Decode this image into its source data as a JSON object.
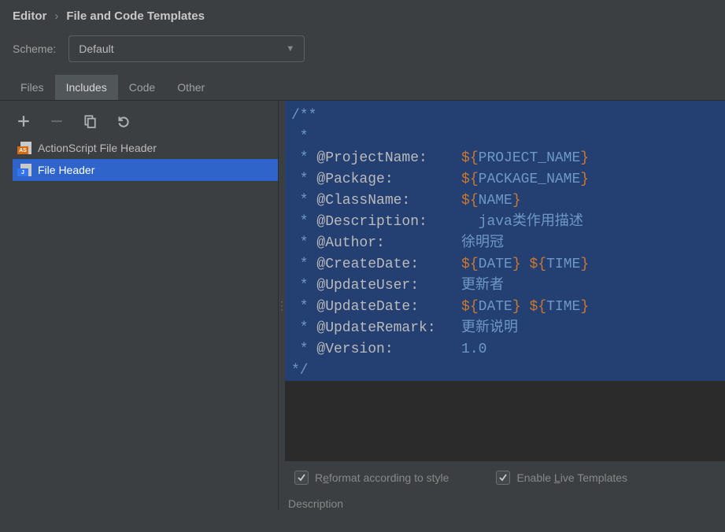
{
  "breadcrumb": {
    "a": "Editor",
    "sep": "›",
    "b": "File and Code Templates"
  },
  "scheme": {
    "label": "Scheme:",
    "value": "Default"
  },
  "tabs": {
    "files": "Files",
    "includes": "Includes",
    "code": "Code",
    "other": "Other"
  },
  "tree": {
    "items": [
      {
        "label": "ActionScript File Header",
        "badge": "AS"
      },
      {
        "label": "File Header",
        "badge": "J"
      }
    ]
  },
  "template": {
    "open": "/**",
    "star": " *",
    "lines": [
      {
        "tag": "@ProjectName:",
        "type": "var",
        "var": "PROJECT_NAME"
      },
      {
        "tag": "@Package:",
        "type": "var",
        "var": "PACKAGE_NAME"
      },
      {
        "tag": "@ClassName:",
        "type": "var",
        "var": "NAME"
      },
      {
        "tag": "@Description:",
        "type": "text",
        "text": "  java类作用描述"
      },
      {
        "tag": "@Author:",
        "type": "text",
        "text": "徐明冠"
      },
      {
        "tag": "@CreateDate:",
        "type": "var2",
        "var": "DATE",
        "var2": "TIME"
      },
      {
        "tag": "@UpdateUser:",
        "type": "text",
        "text": "更新者"
      },
      {
        "tag": "@UpdateDate:",
        "type": "var2",
        "var": "DATE",
        "var2": "TIME"
      },
      {
        "tag": "@UpdateRemark:",
        "type": "text",
        "text": "更新说明"
      },
      {
        "tag": "@Version:",
        "type": "text",
        "text": "1.0"
      }
    ],
    "close": "*/"
  },
  "options": {
    "reformat_pre": "R",
    "reformat_mid": "e",
    "reformat_rest": "format according to style",
    "live_pre": "Enable ",
    "live_mid": "L",
    "live_rest": "ive Templates"
  },
  "desc_label": "Description",
  "glyphs": {
    "dollar_open": "${",
    "close_brace": "}"
  }
}
